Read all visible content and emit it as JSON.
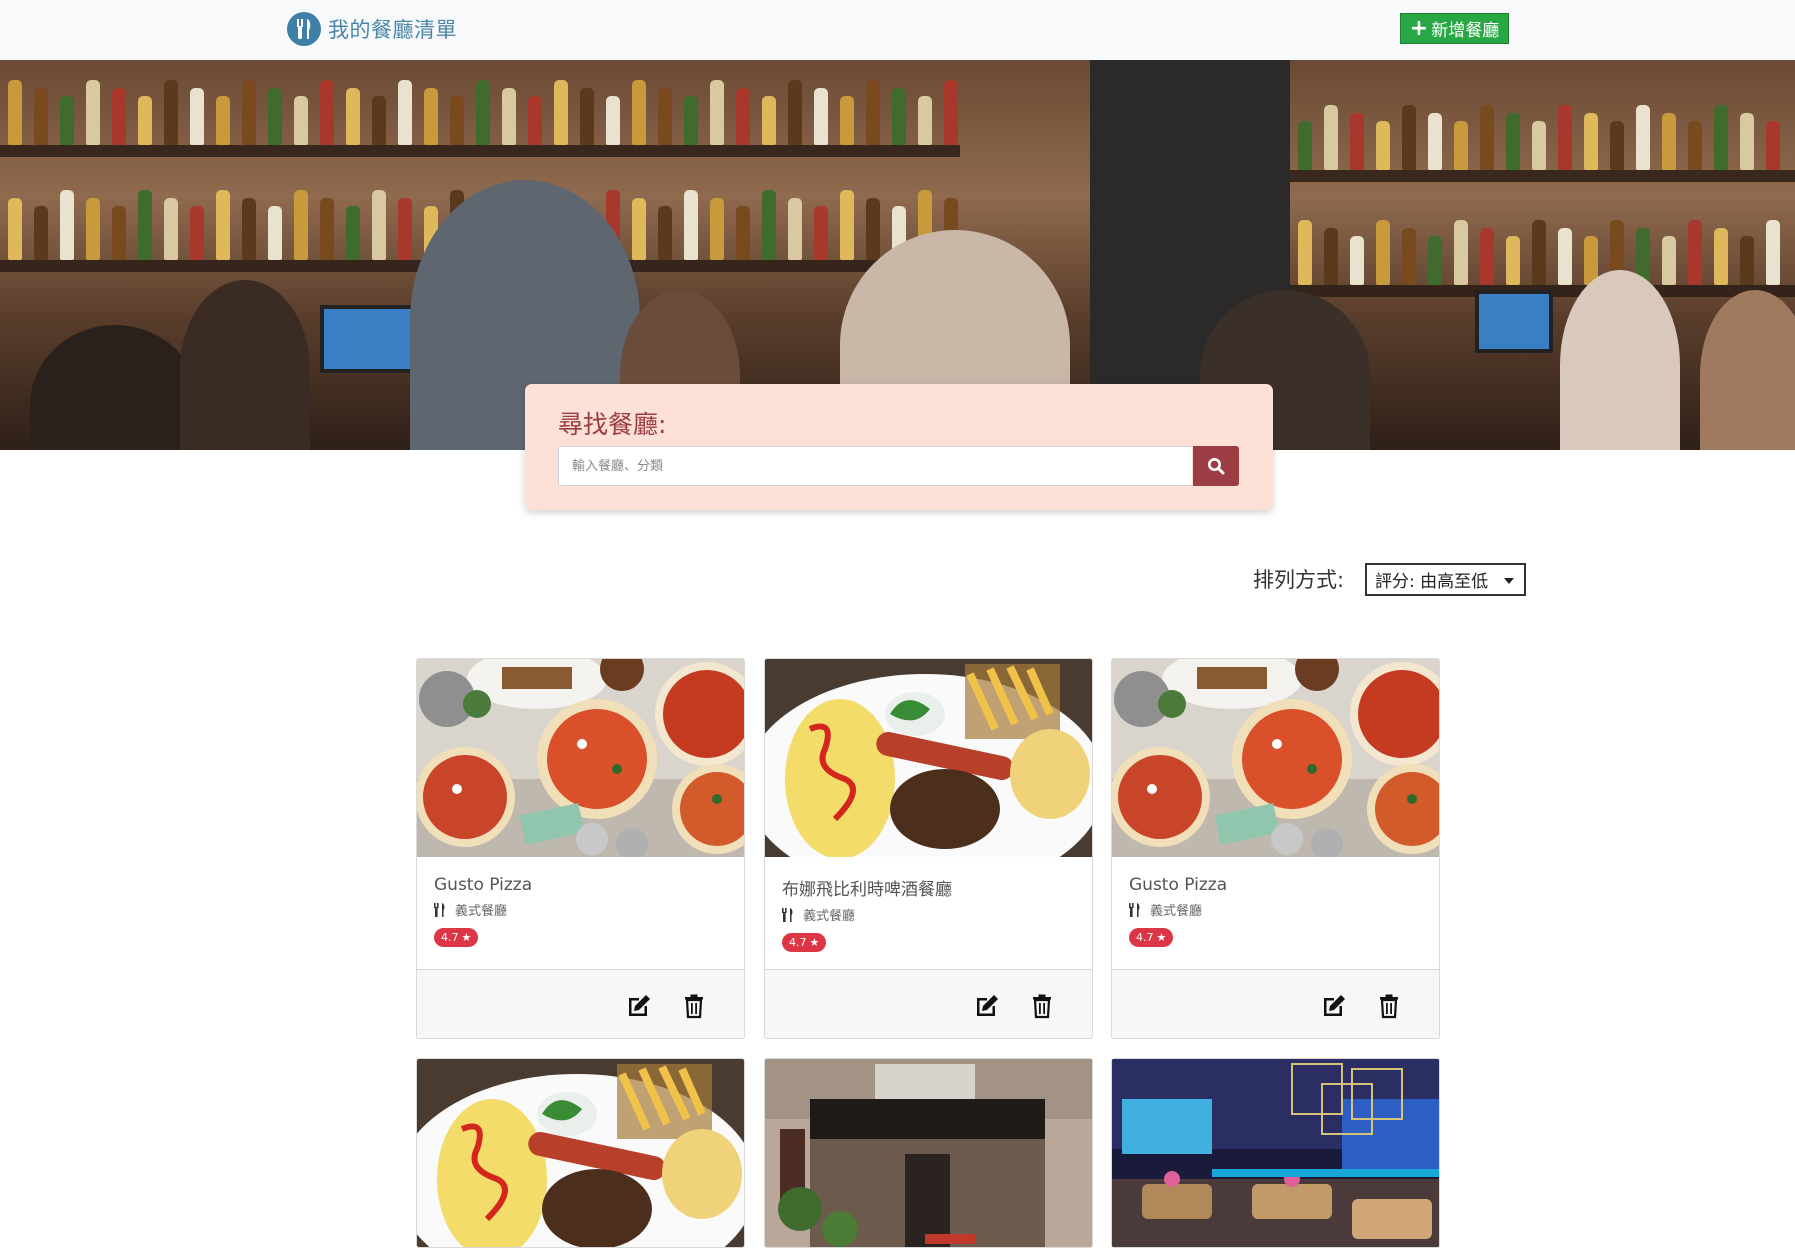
{
  "navbar": {
    "brand_text": "我的餐廳清單",
    "brand_icon": "utensils-icon",
    "add_button_label": "新增餐廳",
    "add_button_icon": "plus-icon",
    "add_button_color": "#28a745"
  },
  "search": {
    "title": "尋找餐廳:",
    "placeholder": "輸入餐廳、分類",
    "value": "",
    "button_icon": "search-icon",
    "accent_color": "#9b3d43",
    "panel_color": "#fde0d6"
  },
  "sort": {
    "label": "排列方式:",
    "selected": "評分: 由高至低"
  },
  "restaurants": [
    {
      "name": "Gusto Pizza",
      "category": "義式餐廳",
      "rating": "4.7",
      "image": "pizza"
    },
    {
      "name": "布娜飛比利時啤酒餐廳",
      "category": "義式餐廳",
      "rating": "4.7",
      "image": "omelette"
    },
    {
      "name": "Gusto Pizza",
      "category": "義式餐廳",
      "rating": "4.7",
      "image": "pizza"
    },
    {
      "name": "",
      "category": "",
      "rating": "",
      "image": "omelette"
    },
    {
      "name": "",
      "category": "",
      "rating": "",
      "image": "storefront"
    },
    {
      "name": "",
      "category": "",
      "rating": "",
      "image": "lounge"
    }
  ],
  "card_actions": {
    "edit_icon": "edit-icon",
    "delete_icon": "trash-icon"
  },
  "colors": {
    "rating_badge": "#dc3545",
    "brand": "#4b86a9"
  }
}
